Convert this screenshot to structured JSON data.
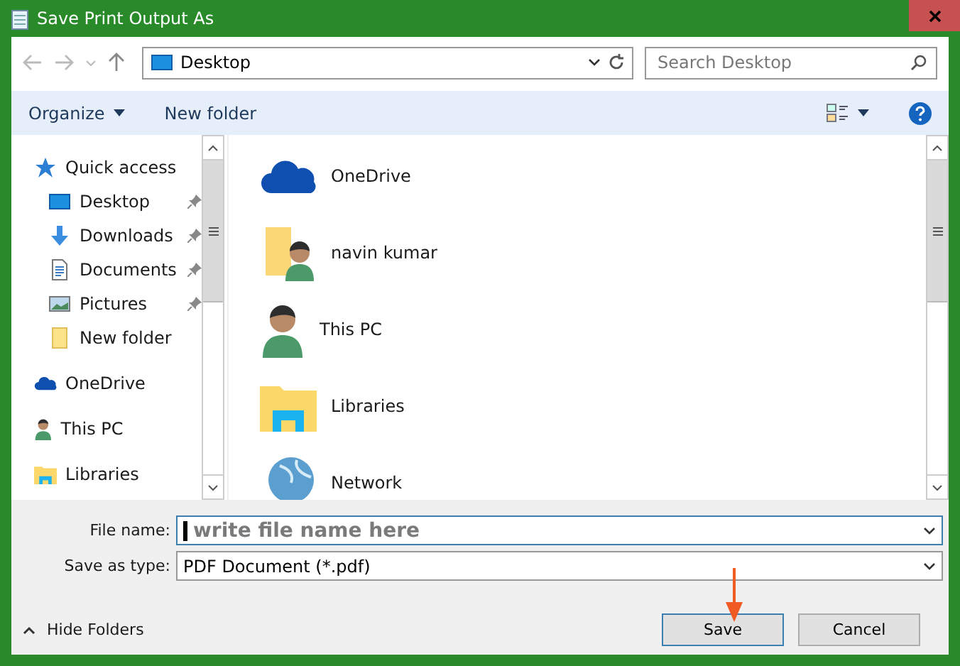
{
  "window": {
    "title": "Save Print Output As"
  },
  "address_bar": {
    "location": "Desktop"
  },
  "search": {
    "placeholder": "Search Desktop"
  },
  "toolbar": {
    "organize": "Organize",
    "new_folder": "New folder"
  },
  "sidebar": {
    "groups": [
      {
        "label": "Quick access",
        "kind": "star",
        "children": [
          {
            "label": "Desktop",
            "kind": "desktop",
            "pinned": true
          },
          {
            "label": "Downloads",
            "kind": "download",
            "pinned": true
          },
          {
            "label": "Documents",
            "kind": "document",
            "pinned": true
          },
          {
            "label": "Pictures",
            "kind": "picture",
            "pinned": true
          },
          {
            "label": "New folder",
            "kind": "folder",
            "pinned": false
          }
        ]
      },
      {
        "label": "OneDrive",
        "kind": "cloud"
      },
      {
        "label": "This PC",
        "kind": "person"
      },
      {
        "label": "Libraries",
        "kind": "library"
      }
    ]
  },
  "items": [
    {
      "label": "OneDrive",
      "kind": "cloud"
    },
    {
      "label": "navin kumar",
      "kind": "user-folder"
    },
    {
      "label": "This PC",
      "kind": "person"
    },
    {
      "label": "Libraries",
      "kind": "library"
    },
    {
      "label": "Network",
      "kind": "globe"
    }
  ],
  "form": {
    "file_name_label": "File name:",
    "file_name_placeholder": "write file name here",
    "type_label": "Save as type:",
    "type_value": "PDF Document (*.pdf)"
  },
  "footer": {
    "hide_folders": "Hide Folders",
    "buttons": [
      {
        "label": "Save",
        "selected": true
      },
      {
        "label": "Cancel",
        "selected": false
      }
    ]
  }
}
